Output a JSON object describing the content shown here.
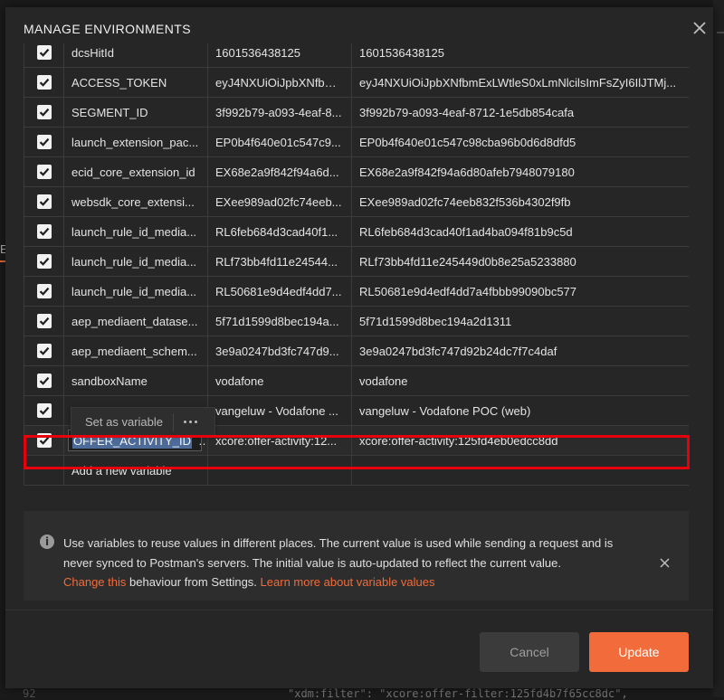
{
  "modal": {
    "title": "MANAGE ENVIRONMENTS"
  },
  "background": {
    "tab_fragment": "E",
    "line_number": "92",
    "code_fragment": "\"xdm:filter\": \"xcore:offer-filter:125fd4b7f65cc8dc\","
  },
  "variables": [
    {
      "key": "dcsHitId",
      "initial": "1601536438125",
      "current": "1601536438125",
      "enabled": true
    },
    {
      "key": "ACCESS_TOKEN",
      "initial": "eyJ4NXUiOiJpbXNfbm...",
      "current": "eyJ4NXUiOiJpbXNfbmExLWtleS0xLmNlcilsImFsZyI6IlJTMj...",
      "enabled": true
    },
    {
      "key": "SEGMENT_ID",
      "initial": "3f992b79-a093-4eaf-8...",
      "current": "3f992b79-a093-4eaf-8712-1e5db854cafa",
      "enabled": true
    },
    {
      "key": "launch_extension_pac...",
      "initial": "EP0b4f640e01c547c9...",
      "current": "EP0b4f640e01c547c98cba96b0d6d8dfd5",
      "enabled": true
    },
    {
      "key": "ecid_core_extension_id",
      "initial": "EX68e2a9f842f94a6d...",
      "current": "EX68e2a9f842f94a6d80afeb7948079180",
      "enabled": true
    },
    {
      "key": "websdk_core_extensi...",
      "initial": "EXee989ad02fc74eeb...",
      "current": "EXee989ad02fc74eeb832f536b4302f9fb",
      "enabled": true
    },
    {
      "key": "launch_rule_id_media...",
      "initial": "RL6feb684d3cad40f1...",
      "current": "RL6feb684d3cad40f1ad4ba094f81b9c5d",
      "enabled": true
    },
    {
      "key": "launch_rule_id_media...",
      "initial": "RLf73bb4fd11e24544...",
      "current": "RLf73bb4fd11e245449d0b8e25a5233880",
      "enabled": true
    },
    {
      "key": "launch_rule_id_media...",
      "initial": "RL50681e9d4edf4dd7...",
      "current": "RL50681e9d4edf4dd7a4fbbb99090bc577",
      "enabled": true
    },
    {
      "key": "aep_mediaent_datase...",
      "initial": "5f71d1599d8bec194a...",
      "current": "5f71d1599d8bec194a2d1311",
      "enabled": true
    },
    {
      "key": "aep_mediaent_schem...",
      "initial": "3e9a0247bd3fc747d9...",
      "current": "3e9a0247bd3fc747d92b24dc7f7c4daf",
      "enabled": true
    },
    {
      "key": "sandboxName",
      "initial": "vodafone",
      "current": "vodafone",
      "enabled": true
    },
    {
      "key": "",
      "initial": "vangeluw - Vodafone ...",
      "current": "vangeluw - Vodafone POC (web)",
      "enabled": true
    },
    {
      "key": "OFFER_ACTIVITY_ID",
      "initial": "xcore:offer-activity:12...",
      "current": "xcore:offer-activity:125fd4eb0edcc8dd",
      "enabled": true,
      "editing": true
    }
  ],
  "new_variable_placeholder": "Add a new variable",
  "hover_toolbar": {
    "label": "Set as variable"
  },
  "info": {
    "text_before_link": "Use variables to reuse values in different places. The current value is used while sending a request and is never synced to Postman's servers. The initial value is auto-updated to reflect the current value.",
    "change_link": "Change this",
    "text_after_link": "behaviour from Settings.",
    "learn_more_link": "Learn more about variable values"
  },
  "buttons": {
    "cancel": "Cancel",
    "update": "Update"
  },
  "colors": {
    "accent": "#f26b3a",
    "highlight_outline": "#e5000b",
    "modal_bg": "#262626"
  }
}
